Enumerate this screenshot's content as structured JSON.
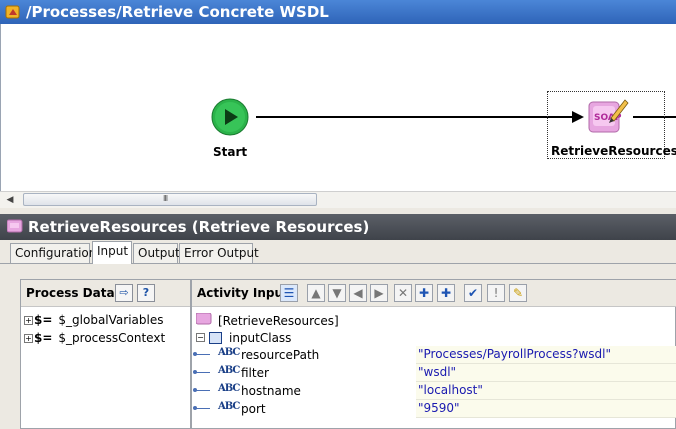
{
  "process_window": {
    "title": "/Processes/Retrieve Concrete WSDL",
    "start_label": "Start",
    "activity_label": "RetrieveResources",
    "soap_icon_text": "SOAP",
    "scroll_grip": "III"
  },
  "activity_panel": {
    "title": "RetrieveResources (Retrieve Resources)",
    "tabs": [
      {
        "label": "Configuration",
        "active": false
      },
      {
        "label": "Input",
        "active": true
      },
      {
        "label": "Output",
        "active": false
      },
      {
        "label": "Error Output",
        "active": false
      }
    ],
    "process_data": {
      "title": "Process Data:",
      "items": [
        {
          "label": "$_globalVariables"
        },
        {
          "label": "$_processContext"
        }
      ]
    },
    "activity_input": {
      "title": "Activity Input:",
      "root": "[RetrieveResources]",
      "class_node": "inputClass",
      "fields": [
        {
          "name": "resourcePath",
          "value": "\"Processes/PayrollProcess?wsdl\""
        },
        {
          "name": "filter",
          "value": "\"wsdl\""
        },
        {
          "name": "hostname",
          "value": "\"localhost\""
        },
        {
          "name": "port",
          "value": "\"9590\""
        }
      ]
    }
  },
  "icons": {
    "abc": "ABC",
    "dollar": "$="
  },
  "colors": {
    "title_blue": "#2f64b8",
    "start_green": "#2bb34a",
    "value_text": "#1a1ab0"
  }
}
